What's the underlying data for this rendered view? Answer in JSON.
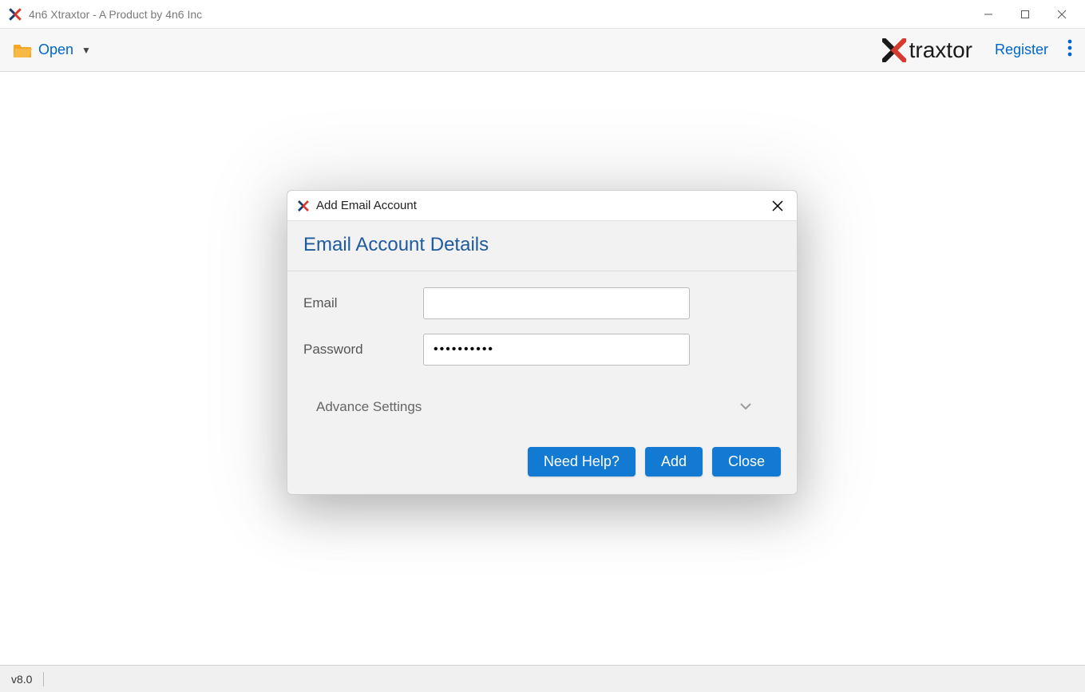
{
  "window": {
    "title": "4n6 Xtraxtor - A Product by 4n6 Inc"
  },
  "toolbar": {
    "open_label": "Open",
    "logo_text": "traxtor",
    "register_label": "Register"
  },
  "modal": {
    "title": "Add Email Account",
    "header": "Email Account Details",
    "email_label": "Email",
    "email_value": "",
    "password_label": "Password",
    "password_value": "••••••••••",
    "advance_label": "Advance Settings",
    "buttons": {
      "help": "Need Help?",
      "add": "Add",
      "close": "Close"
    }
  },
  "statusbar": {
    "version": "v8.0"
  }
}
